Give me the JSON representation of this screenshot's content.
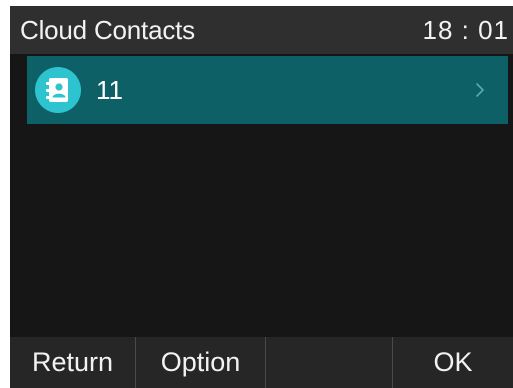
{
  "header": {
    "title": "Cloud Contacts",
    "time": "18 : 01"
  },
  "list": {
    "items": [
      {
        "label": "11",
        "icon": "contacts-book-icon",
        "chevron": "chevron-right-icon"
      }
    ]
  },
  "softkeys": {
    "key1": "Return",
    "key2": "Option",
    "key3": "",
    "key4": "OK"
  },
  "colors": {
    "screen_background": "#161616",
    "header_background": "#2f2f2f",
    "selected_item": "#0d6166",
    "icon_circle": "#2ec4cf",
    "softkey_bar": "#262626"
  }
}
